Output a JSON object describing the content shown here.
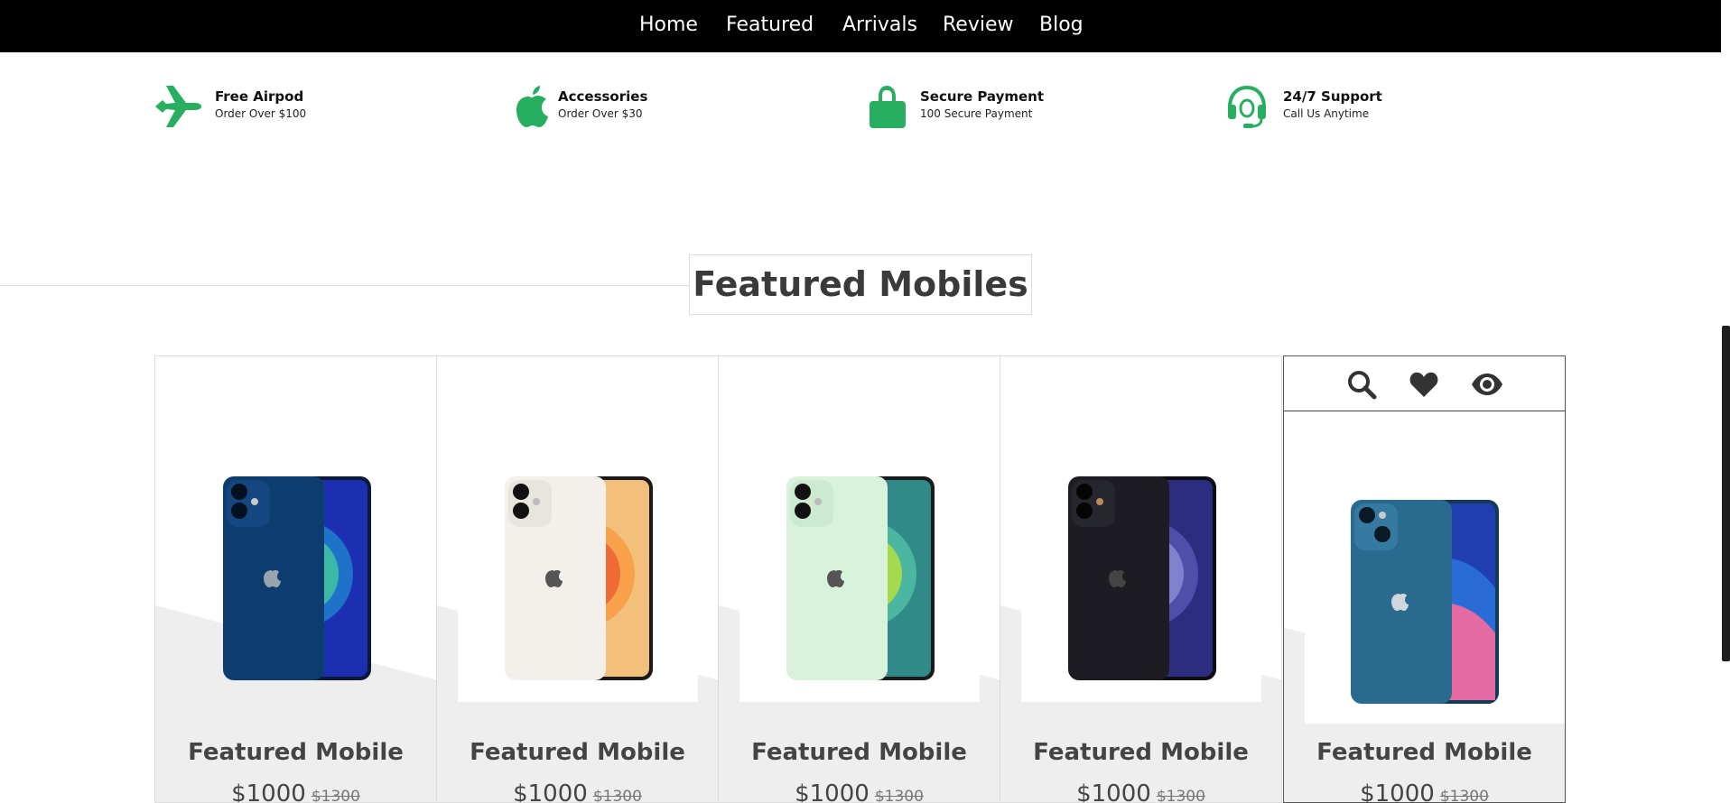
{
  "nav": {
    "items": [
      {
        "label": "Home"
      },
      {
        "label": "Featured"
      },
      {
        "label": "Arrivals"
      },
      {
        "label": "Review"
      },
      {
        "label": "Blog"
      }
    ]
  },
  "features": [
    {
      "icon": "plane-icon",
      "title": "Free Airpod",
      "subtitle": "Order Over $100"
    },
    {
      "icon": "apple-icon",
      "title": "Accessories",
      "subtitle": "Order Over $30"
    },
    {
      "icon": "lock-icon",
      "title": "Secure Payment",
      "subtitle": "100 Secure Payment"
    },
    {
      "icon": "headset-icon",
      "title": "24/7 Support",
      "subtitle": "Call Us Anytime"
    }
  ],
  "section": {
    "heading": "Featured Mobiles"
  },
  "products": [
    {
      "name": "Featured Mobile",
      "price": "$1000",
      "old_price": "$1300",
      "color": "blue"
    },
    {
      "name": "Featured Mobile",
      "price": "$1000",
      "old_price": "$1300",
      "color": "white"
    },
    {
      "name": "Featured Mobile",
      "price": "$1000",
      "old_price": "$1300",
      "color": "green"
    },
    {
      "name": "Featured Mobile",
      "price": "$1000",
      "old_price": "$1300",
      "color": "black"
    },
    {
      "name": "Featured Mobile",
      "price": "$1000",
      "old_price": "$1300",
      "color": "light-blue"
    }
  ],
  "card_actions": [
    "search-icon",
    "heart-icon",
    "eye-icon"
  ],
  "colors": {
    "accent_green": "#27ae60",
    "navbar": "#000000",
    "card_bg_gray": "#eeeeee",
    "text_dark": "#444444"
  }
}
